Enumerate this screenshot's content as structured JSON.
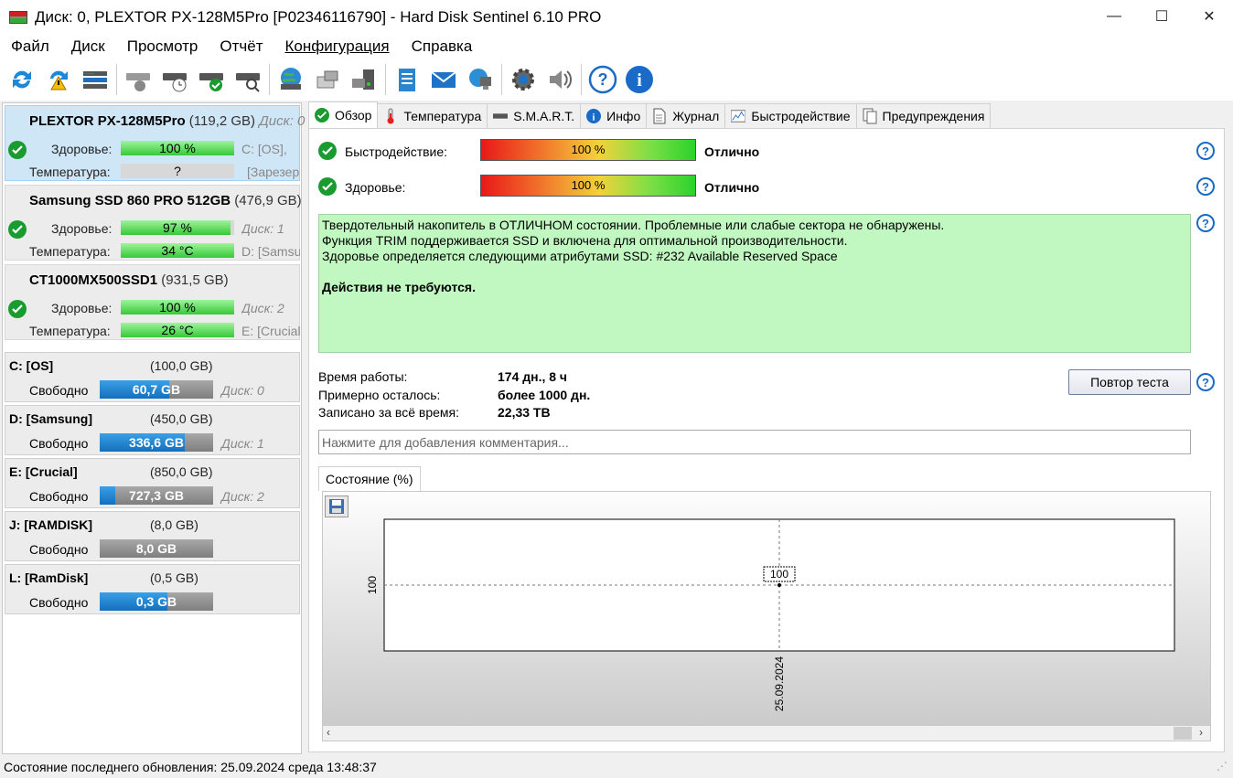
{
  "window": {
    "title": "Диск: 0, PLEXTOR PX-128M5Pro [P02346116790]  -  Hard Disk Sentinel 6.10 PRO",
    "minimize": "—",
    "maximize": "☐",
    "close": "✕"
  },
  "menu": [
    "Файл",
    "Диск",
    "Просмотр",
    "Отчёт",
    "Конфигурация",
    "Справка"
  ],
  "toolbar_icons": [
    "refresh-icon",
    "refresh-warning-icon",
    "disk-list-icon",
    "disk-hide-icon",
    "disk-clock-icon",
    "disk-check-icon",
    "disk-search-icon",
    "globe-disk-icon",
    "network-disk-icon",
    "computer-disk-icon",
    "notepad-icon",
    "mail-icon",
    "network-globe-icon",
    "gear-icon",
    "speaker-icon",
    "help-icon",
    "info-icon"
  ],
  "disks": [
    {
      "name": "PLEXTOR PX-128M5Pro",
      "size": "(119,2 GB)",
      "disk": "Диск: 0",
      "health_label": "Здоровье:",
      "health": "100 %",
      "health_fill": 1.0,
      "temp_label": "Температура:",
      "temp": "?",
      "temp_fill": 0,
      "side1": "C: [OS],",
      "side2": "[Зарезер",
      "selected": true
    },
    {
      "name": "Samsung SSD 860 PRO 512GB",
      "size": "(476,9 GB)",
      "disk": "",
      "health_label": "Здоровье:",
      "health": "97 %",
      "health_fill": 0.97,
      "temp_label": "Температура:",
      "temp": "34 °C",
      "temp_fill": 1.0,
      "side1": "Диск: 1",
      "side2": "D: [Samsu",
      "selected": false
    },
    {
      "name": "CT1000MX500SSD1",
      "size": "(931,5 GB)",
      "disk": "",
      "health_label": "Здоровье:",
      "health": "100 %",
      "health_fill": 1.0,
      "temp_label": "Температура:",
      "temp": "26 °C",
      "temp_fill": 1.0,
      "side1": "Диск: 2",
      "side2": "E: [Crucial",
      "selected": false
    }
  ],
  "volumes": [
    {
      "name": "C: [OS]",
      "size": "(100,0 GB)",
      "free_label": "Свободно",
      "free": "60,7 GB",
      "fill": 0.607,
      "disk": "Диск: 0"
    },
    {
      "name": "D: [Samsung]",
      "size": "(450,0 GB)",
      "free_label": "Свободно",
      "free": "336,6 GB",
      "fill": 0.748,
      "disk": "Диск: 1"
    },
    {
      "name": "E: [Crucial]",
      "size": "(850,0 GB)",
      "free_label": "Свободно",
      "free": "727,3 GB",
      "fill": 0.86,
      "disk": "Диск: 2"
    },
    {
      "name": "J: [RAMDISK]",
      "size": "(8,0 GB)",
      "free_label": "Свободно",
      "free": "8,0 GB",
      "fill": 0,
      "disk": ""
    },
    {
      "name": "L: [RamDisk]",
      "size": "(0,5 GB)",
      "free_label": "Свободно",
      "free": "0,3 GB",
      "fill": 0.6,
      "disk": ""
    }
  ],
  "tabs": [
    {
      "label": "Обзор",
      "icon": "check-icon",
      "active": true
    },
    {
      "label": "Температура",
      "icon": "thermometer-icon",
      "active": false
    },
    {
      "label": "S.M.A.R.T.",
      "icon": "drive-icon",
      "active": false
    },
    {
      "label": "Инфо",
      "icon": "info-icon",
      "active": false
    },
    {
      "label": "Журнал",
      "icon": "document-icon",
      "active": false
    },
    {
      "label": "Быстродействие",
      "icon": "performance-chart-icon",
      "active": false
    },
    {
      "label": "Предупреждения",
      "icon": "warnings-icon",
      "active": false
    }
  ],
  "overview": {
    "performance_label": "Быстродействие:",
    "performance_value": "100 %",
    "performance_verdict": "Отлично",
    "health_label": "Здоровье:",
    "health_value": "100 %",
    "health_verdict": "Отлично",
    "status_lines": [
      "Твердотельный накопитель в ОТЛИЧНОМ состоянии. Проблемные или слабые сектора не обнаружены.",
      "Функция TRIM поддерживается SSD и включена для оптимальной производительности.",
      "Здоровье определяется следующими атрибутами SSD: #232 Available Reserved Space"
    ],
    "status_action": "Действия не требуются.",
    "uptime_label": "Время работы:",
    "uptime": "174 дн., 8 ч",
    "remaining_label": "Примерно осталось:",
    "remaining": "более 1000 дн.",
    "written_label": "Записано за всё время:",
    "written": "22,33 TB",
    "retest_button": "Повтор теста",
    "comment_placeholder": "Нажмите для добавления комментария...",
    "chart_tab": "Состояние (%)",
    "help": "?"
  },
  "chart_data": {
    "type": "line",
    "title": "Состояние (%)",
    "x": [
      "25.09.2024"
    ],
    "values": [
      100
    ],
    "point_label": "100",
    "ytick": "100",
    "xtick": "25.09.2024"
  },
  "statusbar": "Состояние последнего обновления: 25.09.2024 среда 13:48:37"
}
